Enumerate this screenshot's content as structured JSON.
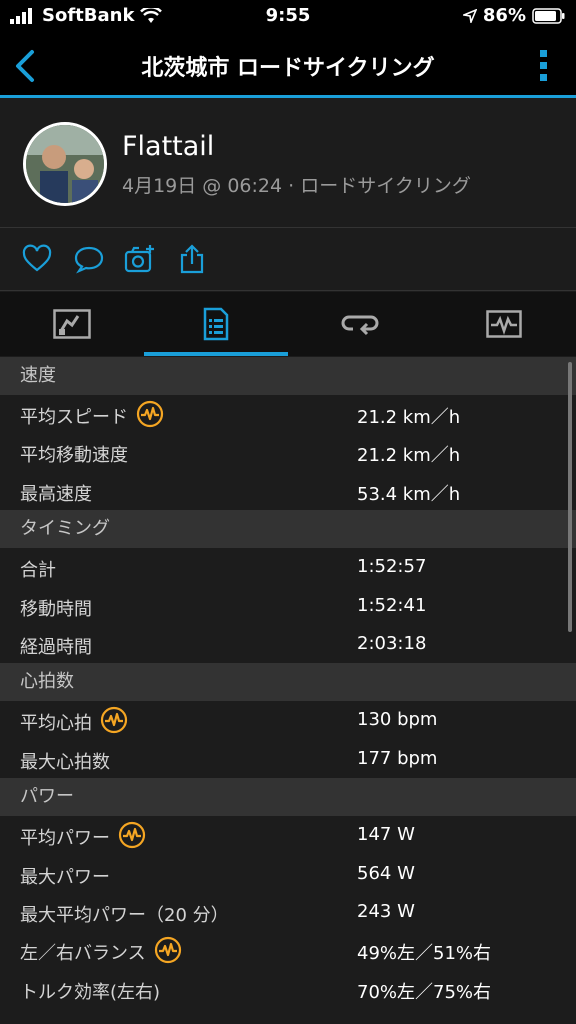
{
  "status": {
    "carrier": "SoftBank",
    "time": "9:55",
    "battery": "86%"
  },
  "nav": {
    "title": "北茨城市 ロードサイクリング"
  },
  "profile": {
    "name": "Flattail",
    "meta": "4月19日 @ 06:24 · ロードサイクリング"
  },
  "icons": {
    "accent": "#1a9fd9",
    "badge_color": "#f5a623"
  },
  "sections": [
    {
      "title": "速度",
      "rows": [
        {
          "label": "平均スピード",
          "value": "21.2 km／h",
          "badge": true
        },
        {
          "label": "平均移動速度",
          "value": "21.2 km／h",
          "badge": false
        },
        {
          "label": "最高速度",
          "value": "53.4 km／h",
          "badge": false
        }
      ]
    },
    {
      "title": "タイミング",
      "rows": [
        {
          "label": "合計",
          "value": "1:52:57",
          "badge": false
        },
        {
          "label": "移動時間",
          "value": "1:52:41",
          "badge": false
        },
        {
          "label": "経過時間",
          "value": "2:03:18",
          "badge": false
        }
      ]
    },
    {
      "title": "心拍数",
      "rows": [
        {
          "label": "平均心拍",
          "value": "130 bpm",
          "badge": true
        },
        {
          "label": "最大心拍数",
          "value": "177 bpm",
          "badge": false
        }
      ]
    },
    {
      "title": "パワー",
      "rows": [
        {
          "label": "平均パワー",
          "value": "147 W",
          "badge": true
        },
        {
          "label": "最大パワー",
          "value": "564 W",
          "badge": false
        },
        {
          "label": "最大平均パワー（20 分）",
          "value": "243 W",
          "badge": false
        },
        {
          "label": "左／右バランス",
          "value": "49%左／51%右",
          "badge": true
        },
        {
          "label": "トルク効率(左右)",
          "value": "70%左／75%右",
          "badge": false
        }
      ]
    }
  ]
}
